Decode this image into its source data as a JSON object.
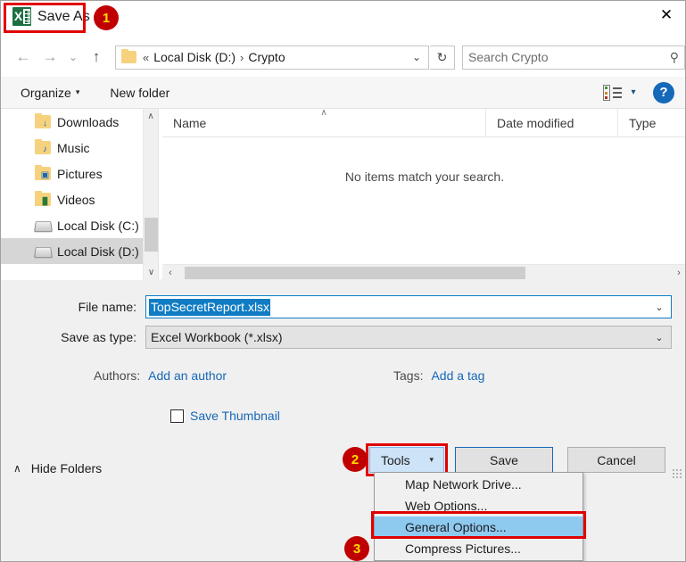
{
  "window": {
    "title": "Save As",
    "app_icon": "excel-icon",
    "close_label": "✕"
  },
  "annotations": {
    "badge1": "1",
    "badge2": "2",
    "badge3": "3",
    "badge_bg": "#c00000",
    "badge_fg": "#ffe000",
    "highlight_color": "#e00000"
  },
  "nav": {
    "back": "←",
    "forward": "→",
    "recent": "⌄",
    "up": "↑",
    "breadcrumb_prefix": "«",
    "breadcrumb": [
      "Local Disk (D:)",
      "Crypto"
    ],
    "breadcrumb_sep": "›",
    "address_chevron": "⌄",
    "refresh": "↻"
  },
  "search": {
    "placeholder": "Search Crypto",
    "icon": "search-icon",
    "icon_glyph": "⚲"
  },
  "commandbar": {
    "organize": "Organize",
    "organize_caret": "▾",
    "new_folder": "New folder",
    "view_caret": "▾",
    "help": "?"
  },
  "sidebar": {
    "items": [
      {
        "label": "Downloads",
        "icon": "folder-downloads-icon",
        "glyph": "↓",
        "type": "folder",
        "selected": false
      },
      {
        "label": "Music",
        "icon": "folder-music-icon",
        "glyph": "♪",
        "type": "folder",
        "selected": false
      },
      {
        "label": "Pictures",
        "icon": "folder-pictures-icon",
        "glyph": "▣",
        "type": "folder",
        "selected": false
      },
      {
        "label": "Videos",
        "icon": "folder-videos-icon",
        "glyph": "█",
        "type": "folder",
        "selected": false
      },
      {
        "label": "Local Disk (C:)",
        "icon": "drive-windows-icon",
        "glyph": "",
        "type": "drive-windows",
        "selected": false
      },
      {
        "label": "Local Disk (D:)",
        "icon": "drive-icon",
        "glyph": "",
        "type": "drive",
        "selected": true
      }
    ],
    "scroll_up": "∧",
    "scroll_down": "∨"
  },
  "filelist": {
    "columns": [
      "Name",
      "Date modified",
      "Type"
    ],
    "sort_caret": "∧",
    "empty_message": "No items match your search.",
    "rows": [],
    "scroll_left": "‹",
    "scroll_right": "›"
  },
  "form": {
    "filename_label": "File name:",
    "filename_value": "TopSecretReport.xlsx",
    "filename_selected": true,
    "filetype_label": "Save as type:",
    "filetype_value": "Excel Workbook (*.xlsx)",
    "combo_chevron": "⌄",
    "authors_label": "Authors:",
    "authors_value": "Add an author",
    "tags_label": "Tags:",
    "tags_value": "Add a tag",
    "save_thumbnail_label": "Save Thumbnail",
    "save_thumbnail_checked": false,
    "hide_folders_label": "Hide Folders",
    "hide_folders_caret": "∧"
  },
  "buttons": {
    "tools": "Tools",
    "tools_caret": "▾",
    "save": "Save",
    "cancel": "Cancel"
  },
  "tools_menu": {
    "items": [
      {
        "label": "Map Network Drive...",
        "highlighted": false
      },
      {
        "label": "Web Options...",
        "highlighted": false
      },
      {
        "label": "General Options...",
        "highlighted": true
      },
      {
        "label": "Compress Pictures...",
        "highlighted": false
      }
    ]
  }
}
